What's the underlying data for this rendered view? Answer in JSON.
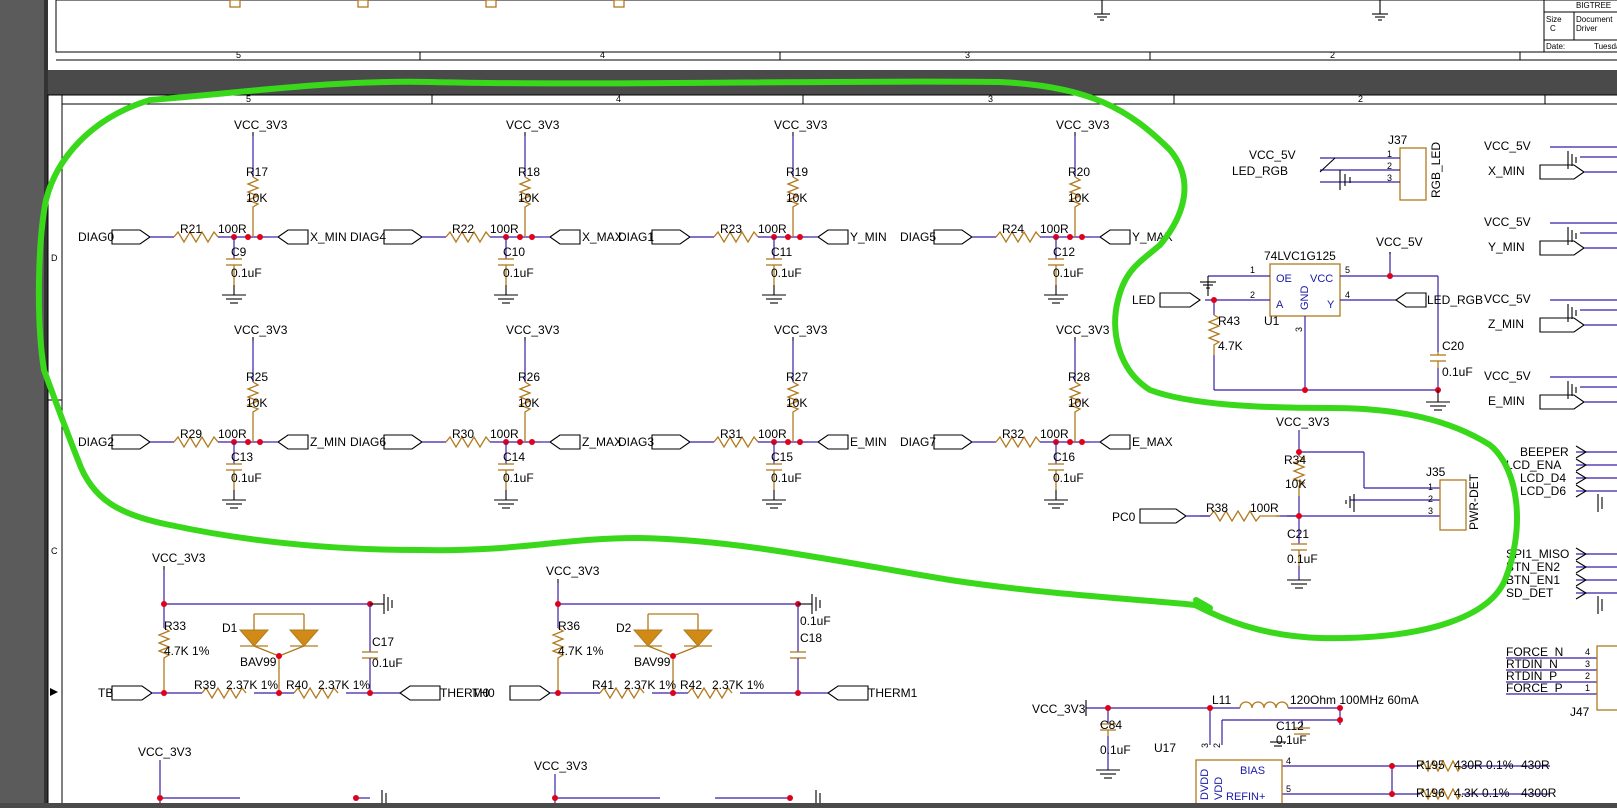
{
  "sheet_top": {
    "zone_numbers": [
      "5",
      "4",
      "3",
      "2"
    ],
    "title_block": {
      "company": "BIGTREE",
      "size_label": "Size",
      "size_value": "C",
      "document_label": "Document",
      "document_value": "Driver",
      "date_label": "Date:",
      "date_value": "Tuesda"
    }
  },
  "sheet_main": {
    "zone_numbers": [
      "5",
      "4",
      "3",
      "2"
    ],
    "row_letters": [
      "D",
      "C"
    ]
  },
  "endstop_filters": [
    {
      "input": "DIAG0",
      "series_res": "R21",
      "series_val": "100R",
      "pullup": "R17",
      "pullup_val": "10K",
      "cap": "C9",
      "cap_val": "0.1uF",
      "output": "X_MIN",
      "supply": "VCC_3V3"
    },
    {
      "input": "DIAG4",
      "series_res": "R22",
      "series_val": "100R",
      "pullup": "R18",
      "pullup_val": "10K",
      "cap": "C10",
      "cap_val": "0.1uF",
      "output": "X_MAX",
      "supply": "VCC_3V3"
    },
    {
      "input": "DIAG1",
      "series_res": "R23",
      "series_val": "100R",
      "pullup": "R19",
      "pullup_val": "10K",
      "cap": "C11",
      "cap_val": "0.1uF",
      "output": "Y_MIN",
      "supply": "VCC_3V3"
    },
    {
      "input": "DIAG5",
      "series_res": "R24",
      "series_val": "100R",
      "pullup": "R20",
      "pullup_val": "10K",
      "cap": "C12",
      "cap_val": "0.1uF",
      "output": "Y_MAX",
      "supply": "VCC_3V3"
    },
    {
      "input": "DIAG2",
      "series_res": "R29",
      "series_val": "100R",
      "pullup": "R25",
      "pullup_val": "10K",
      "cap": "C13",
      "cap_val": "0.1uF",
      "output": "Z_MIN",
      "supply": "VCC_3V3"
    },
    {
      "input": "DIAG6",
      "series_res": "R30",
      "series_val": "100R",
      "pullup": "R26",
      "pullup_val": "10K",
      "cap": "C14",
      "cap_val": "0.1uF",
      "output": "Z_MAX",
      "supply": "VCC_3V3"
    },
    {
      "input": "DIAG3",
      "series_res": "R31",
      "series_val": "100R",
      "pullup": "R27",
      "pullup_val": "10K",
      "cap": "C15",
      "cap_val": "0.1uF",
      "output": "E_MIN",
      "supply": "VCC_3V3"
    },
    {
      "input": "DIAG7",
      "series_res": "R32",
      "series_val": "100R",
      "pullup": "R28",
      "pullup_val": "10K",
      "cap": "C16",
      "cap_val": "0.1uF",
      "output": "E_MAX",
      "supply": "VCC_3V3"
    }
  ],
  "rgb_connector": {
    "ref": "J37",
    "name": "RGB_LED",
    "supply": "VCC_5V",
    "signal": "LED_RGB",
    "pins": [
      "1",
      "2",
      "3"
    ]
  },
  "buffer": {
    "ref": "U1",
    "part": "74LVC1G125",
    "pin_oe": "OE",
    "pin_a": "A",
    "pin_gnd": "GND",
    "pin_vcc": "VCC",
    "pin_y": "Y",
    "num_oe": "1",
    "num_a": "2",
    "num_gnd": "3",
    "num_y": "4",
    "num_vcc": "5",
    "supply": "VCC_5V",
    "input": "LED",
    "output": "LED_RGB",
    "pulldown": "R43",
    "pulldown_val": "4.7K",
    "cap": "C20",
    "cap_val": "0.1uF"
  },
  "power_detect": {
    "supply": "VCC_3V3",
    "pullup": "R34",
    "pullup_val": "10K",
    "input": "PC0",
    "series_res": "R38",
    "series_val": "100R",
    "cap": "C21",
    "cap_val": "0.1uF",
    "connector": "J35",
    "connector_name": "PWR-DET",
    "pins": [
      "1",
      "2",
      "3"
    ]
  },
  "right_connectors": [
    {
      "supply": "VCC_5V",
      "signal": "X_MIN"
    },
    {
      "supply": "VCC_5V",
      "signal": "Y_MIN"
    },
    {
      "supply": "VCC_5V",
      "signal": "Z_MIN"
    },
    {
      "supply": "VCC_5V",
      "signal": "E_MIN"
    }
  ],
  "right_signals_a": [
    "BEEPER",
    "LCD_ENA",
    "LCD_D4",
    "LCD_D6"
  ],
  "right_signals_b": [
    "SPI1_MISO",
    "BTN_EN2",
    "BTN_EN1",
    "SD_DET"
  ],
  "thermistors": [
    {
      "supply": "VCC_3V3",
      "pullup": "R33",
      "pullup_val": "4.7K 1%",
      "diode": "D1",
      "diode_part": "BAV99",
      "cap": "C17",
      "cap_val": "0.1uF",
      "input": "TB",
      "r1": "R39",
      "r1_val": "2.37K 1%",
      "r2": "R40",
      "r2_val": "2.37K 1%",
      "output": "THERM0"
    },
    {
      "supply": "VCC_3V3",
      "pullup": "R36",
      "pullup_val": "4.7K 1%",
      "diode": "D2",
      "diode_part": "BAV99",
      "cap": "C18",
      "cap_val": "0.1uF",
      "input": "TH0",
      "r1": "R41",
      "r1_val": "2.37K 1%",
      "r2": "R42",
      "r2_val": "2.37K 1%",
      "output": "THERM1"
    }
  ],
  "rtd": {
    "supply": "VCC_3V3",
    "inductor": "L11",
    "inductor_val": "120Ohm 100MHz 60mA",
    "cap1": "C84",
    "cap1_val": "0.1uF",
    "cap2": "C112",
    "cap2_val": "0.1uF",
    "ic": "U17",
    "pin_dvdd": "DVDD",
    "pin_vdd": "VDD",
    "pin_bias": "BIAS",
    "pin_refin": "REFIN+",
    "num_dvdd": "3",
    "num_vdd": "2",
    "num_bias": "4",
    "num_refin": "5",
    "r1": "R195",
    "r1_val": "430R 0.1%",
    "r1_net": "430R",
    "r2": "R196",
    "r2_val": "4.3K 0.1%",
    "r2_net": "4300R"
  },
  "rtd_connector": {
    "ref": "J47",
    "signals": [
      "FORCE_N",
      "RTDIN_N",
      "RTDIN_P",
      "FORCE_P"
    ],
    "pins": [
      "4",
      "3",
      "2",
      "1"
    ]
  },
  "bottom_supplies": [
    "VCC_3V3",
    "VCC_3V3"
  ],
  "colors": {
    "annotation": "#39d81b",
    "wire": "#3b1fa8",
    "component": "#b07a1e",
    "junction": "#e0001a",
    "background": "#4a4a4a"
  }
}
